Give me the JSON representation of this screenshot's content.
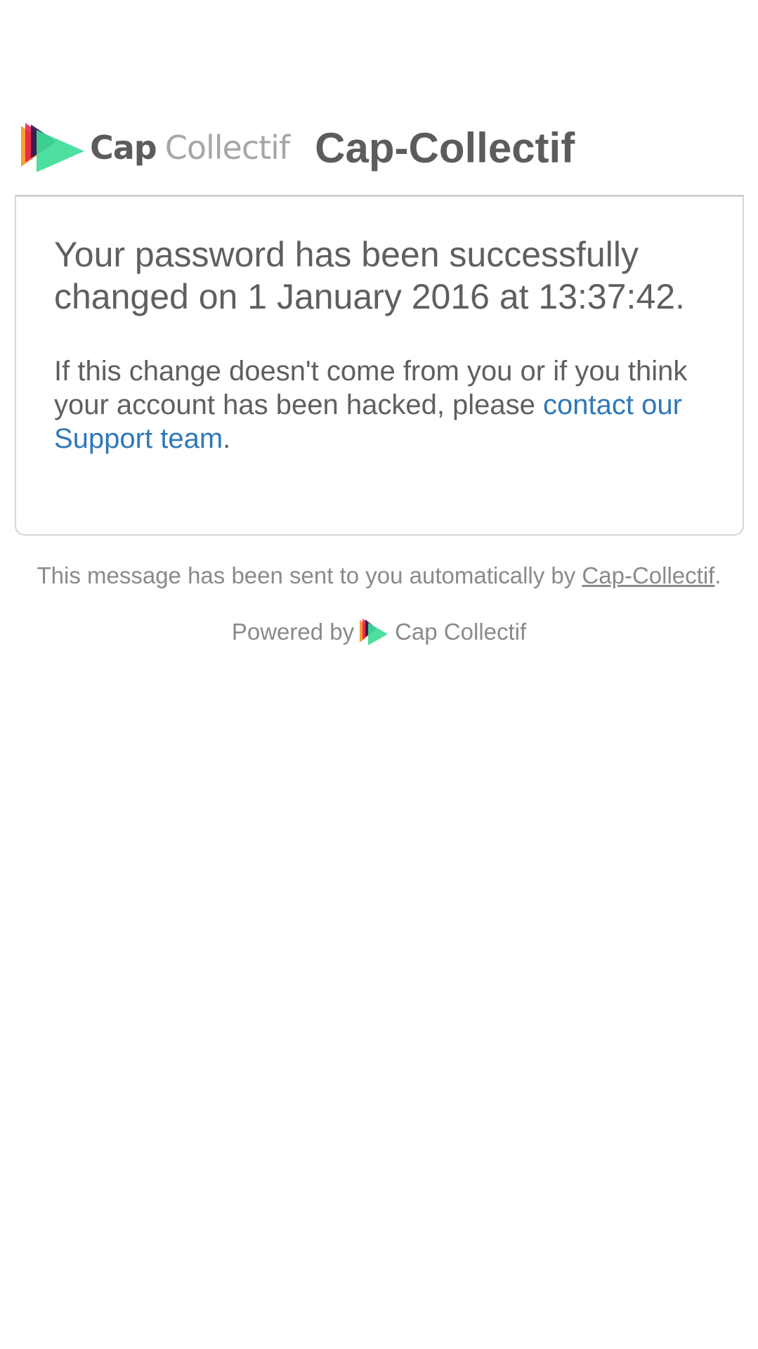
{
  "header": {
    "logo_word_cap": "Cap",
    "logo_word_collectif": "Collectif",
    "site_name": "Cap-Collectif"
  },
  "card": {
    "heading": "Your password has been successfully changed on 1 January 2016 at 13:37:42.",
    "body_prefix": "If this change doesn't come from you or if you think your account has been hacked, please ",
    "support_link_text": "contact our Support team",
    "body_suffix": "."
  },
  "footer": {
    "note_prefix": "This message has been sent to you automatically by ",
    "note_link": "Cap-Collectif",
    "note_suffix": ".",
    "powered_by": "Powered by",
    "powered_brand": "Cap Collectif"
  },
  "colors": {
    "link": "#2f78b7",
    "text": "#5f5f5f",
    "muted": "#8a8a8a",
    "logo_green": "#3ddc97",
    "logo_orange": "#f7931e",
    "logo_red": "#e8194d",
    "logo_dark": "#2b1a4f"
  },
  "icons": {
    "brand_logo": "cap-collectif-play-icon",
    "powered_logo": "cap-collectif-play-icon"
  }
}
